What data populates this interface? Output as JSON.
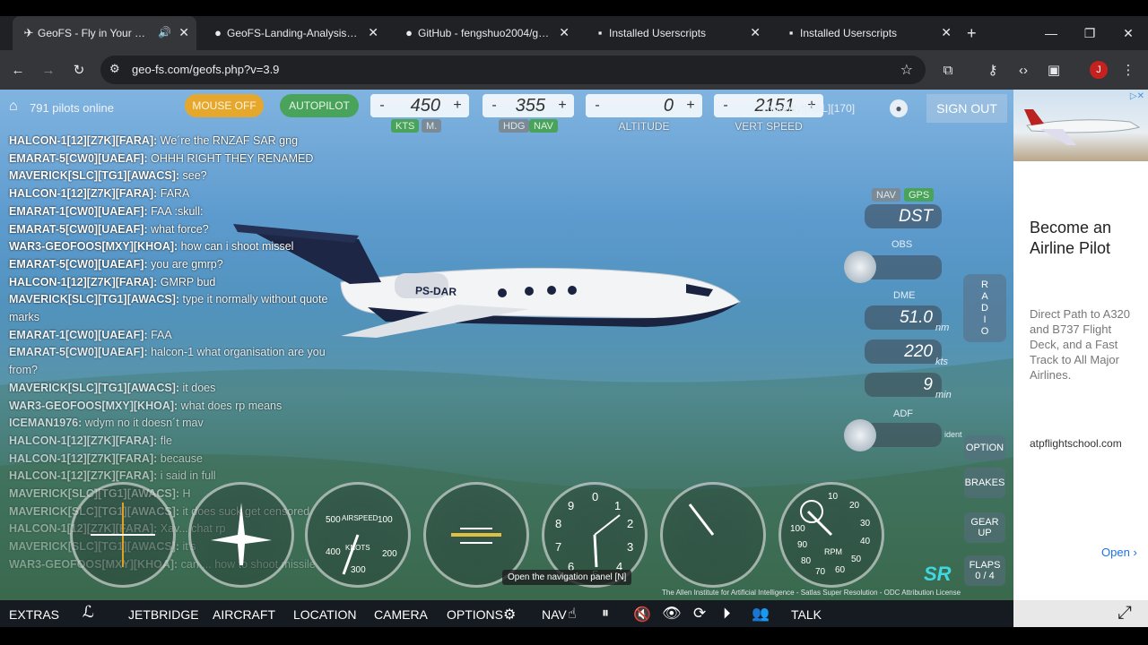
{
  "browser": {
    "tabs": [
      {
        "label": "GeoFS - Fly in Your Web B",
        "icon": "geofs-icon",
        "audio": true
      },
      {
        "label": "GeoFS-Landing-Analysis/main",
        "icon": "github-icon"
      },
      {
        "label": "GitHub - fengshuo2004/geof",
        "icon": "github-icon"
      },
      {
        "label": "Installed Userscripts",
        "icon": "userscripts-icon"
      },
      {
        "label": "Installed Userscripts",
        "icon": "userscripts-icon"
      }
    ],
    "new_tab": "+",
    "url": "geo-fs.com/geofs.php?v=3.9",
    "profile_initial": "J"
  },
  "game": {
    "pilots_online": "791 pilots online",
    "mouse_btn": "MOUSE OFF",
    "autopilot_btn": "AUTOPILOT",
    "speed": {
      "value": "450",
      "unit1": "KTS",
      "unit2": "M."
    },
    "heading": {
      "value": "355",
      "mode1": "HDG",
      "mode2": "NAV"
    },
    "altitude": {
      "value": "0",
      "label": "ALTITUDE"
    },
    "vspeed": {
      "value": "2151",
      "label": "VERT SPEED"
    },
    "callsign": "...hgeofly][AAL][170]",
    "sign_out": "SIGN OUT",
    "chat": [
      {
        "name": "HALCON-1[12][Z7K][FARA]:",
        "msg": "We´re the RNZAF SAR gng"
      },
      {
        "name": "EMARAT-5[CW0][UAEAF]:",
        "msg": "OHHH RIGHT THEY RENAMED"
      },
      {
        "name": "MAVERICK[SLC][TG1][AWACS]:",
        "msg": "see?"
      },
      {
        "name": "HALCON-1[12][Z7K][FARA]:",
        "msg": "FARA"
      },
      {
        "name": "EMARAT-1[CW0][UAEAF]:",
        "msg": "FAA :skull:"
      },
      {
        "name": "EMARAT-5[CW0][UAEAF]:",
        "msg": "what force?"
      },
      {
        "name": "WAR3-GEOFOOS[MXY][KHOA]:",
        "msg": "how can i shoot missel"
      },
      {
        "name": "EMARAT-5[CW0][UAEAF]:",
        "msg": "you are gmrp?"
      },
      {
        "name": "HALCON-1[12][Z7K][FARA]:",
        "msg": "GMRP bud"
      },
      {
        "name": "MAVERICK[SLC][TG1][AWACS]:",
        "msg": "type it normally without quote marks"
      },
      {
        "name": "EMARAT-1[CW0][UAEAF]:",
        "msg": "FAA"
      },
      {
        "name": "EMARAT-5[CW0][UAEAF]:",
        "msg": "halcon-1 what organisation are you from?"
      },
      {
        "name": "MAVERICK[SLC][TG1][AWACS]:",
        "msg": "it does"
      },
      {
        "name": "WAR3-GEOFOOS[MXY][KHOA]:",
        "msg": "what does rp means"
      },
      {
        "name": "ICEMAN1976:",
        "msg": "wdym no it doesn´t mav"
      },
      {
        "name": "HALCON-1[12][Z7K][FARA]:",
        "msg": "fle"
      },
      {
        "name": "HALCON-1[12][Z7K][FARA]:",
        "msg": "because"
      },
      {
        "name": "HALCON-1[12][Z7K][FARA]:",
        "msg": "i said in full"
      },
      {
        "name": "MAVERICK[SLC][TG1][AWACS]:",
        "msg": "H"
      },
      {
        "name": "MAVERICK[SLC][TG1][AWACS]:",
        "msg": "it does suck get censored"
      },
      {
        "name": "HALCON-1[12][Z7K][FARA]:",
        "msg": "Xav... chat rp"
      },
      {
        "name": "MAVERICK[SLC][TG1][AWACS]:",
        "msg": "it's"
      },
      {
        "name": "WAR3-GEOFOOS[MXY][KHOA]:",
        "msg": "can ... how to shoot missile"
      }
    ],
    "aircraft_reg": "PS-DAR",
    "nav": {
      "nav_mode": "NAV",
      "gps_mode": "GPS",
      "dst": "DST",
      "obs_label": "OBS",
      "dme_label": "DME",
      "dme_value": "51.0",
      "dme_unit": "nm",
      "speed_value": "220",
      "speed_unit": "kts",
      "time_value": "9",
      "time_unit": "min",
      "adf_label": "ADF",
      "ident": "ident",
      "radio": "RADIO"
    },
    "side_buttons": {
      "option": "OPTION",
      "brakes": "BRAKES",
      "gear": "GEAR UP",
      "flaps": "FLAPS",
      "flaps_value": "0 / 4"
    },
    "gauges": {
      "airspeed_label": "AIRSPEED",
      "airspeed_unit": "KNOTS",
      "airspeed_ticks": [
        "100",
        "200",
        "300",
        "400",
        "500"
      ],
      "rpm_label": "RPM",
      "rpm_ticks": [
        "10",
        "20",
        "30",
        "40",
        "50",
        "60",
        "70",
        "80",
        "90",
        "100"
      ],
      "alt_ticks": [
        "0",
        "1",
        "2",
        "3",
        "4",
        "5",
        "6",
        "7",
        "8",
        "9"
      ]
    },
    "sr_logo": "SR",
    "tooltip": "Open the navigation panel [N]",
    "attribution": "The Allen Institute for Artificial Intelligence - Satlas Super Resolution - ODC Attribution License"
  },
  "bottom_bar": {
    "extras": "EXTRAS",
    "jetbridge": "JETBRIDGE",
    "aircraft": "AIRCRAFT",
    "location": "LOCATION",
    "camera": "CAMERA",
    "options": "OPTIONS",
    "nav": "NAV",
    "talk": "TALK"
  },
  "ad": {
    "headline": "Become an Airline Pilot",
    "body": "Direct Path to A320 and B737 Flight Deck, and a Fast Track to All Major Airlines.",
    "domain": "atpflightschool.com",
    "cta": "Open"
  }
}
